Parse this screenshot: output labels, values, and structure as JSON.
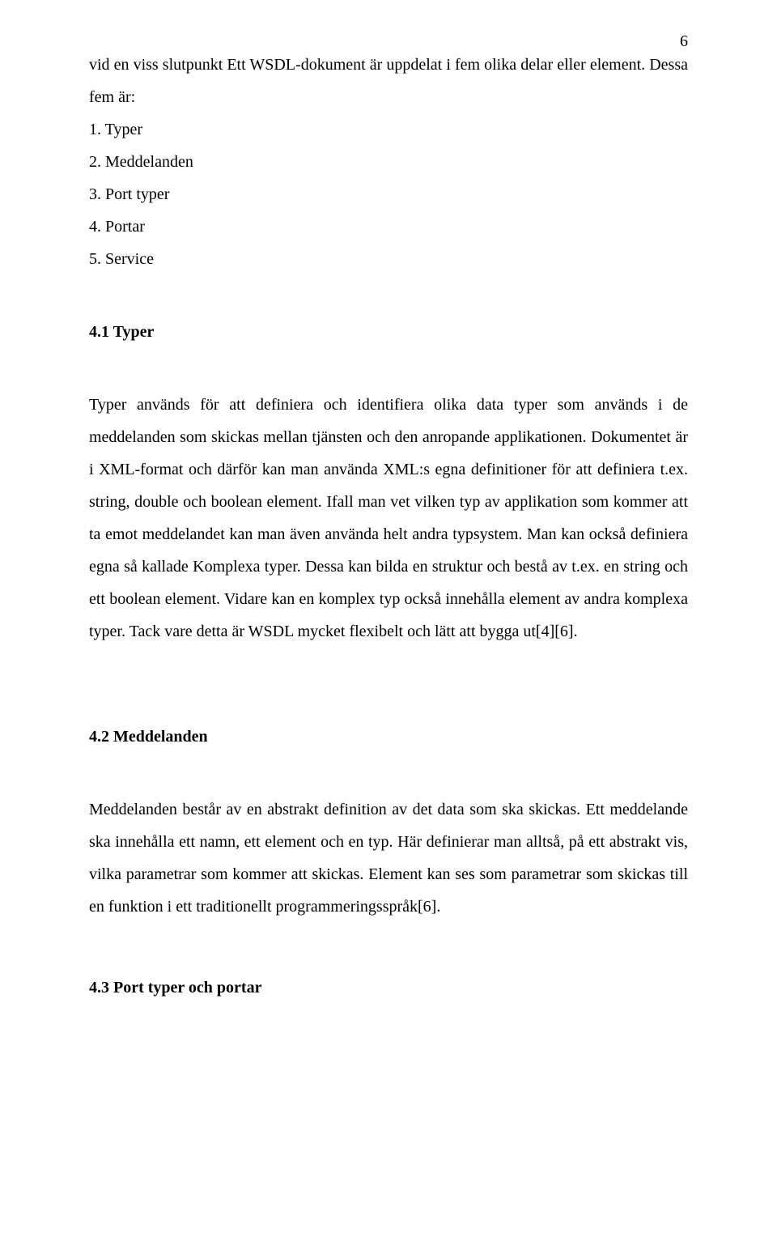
{
  "page_number": "6",
  "lead_in": "vid en viss slutpunkt Ett WSDL-dokument är uppdelat i fem olika delar eller element. Dessa fem är:",
  "list_items": [
    "1. Typer",
    "2. Meddelanden",
    "3. Port typer",
    "4. Portar",
    "5. Service"
  ],
  "section_4_1": {
    "heading": "4.1 Typer",
    "body": "Typer används för att definiera och identifiera olika data typer som används i de meddelanden som skickas mellan tjänsten och den anropande applikationen. Dokumentet är i XML-format och därför kan man använda XML:s egna definitioner för att definiera t.ex. string, double och boolean element. Ifall man vet vilken typ av applikation som kommer att ta emot meddelandet kan man även använda helt andra typsystem. Man kan också definiera egna så kallade Komplexa typer. Dessa kan bilda en struktur och bestå av t.ex. en string och ett boolean element. Vidare kan en komplex typ också innehålla element av andra komplexa typer. Tack vare detta är WSDL mycket flexibelt och lätt att bygga ut[4][6]."
  },
  "section_4_2": {
    "heading": "4.2 Meddelanden",
    "body": "Meddelanden består av en abstrakt definition av det data som ska skickas. Ett meddelande ska innehålla ett namn, ett element och en typ. Här definierar man alltså, på ett abstrakt vis, vilka parametrar som kommer att skickas. Element kan ses som parametrar som skickas till en funktion i ett traditionellt programmeringsspråk[6]."
  },
  "section_4_3": {
    "heading": "4.3 Port typer och portar"
  }
}
